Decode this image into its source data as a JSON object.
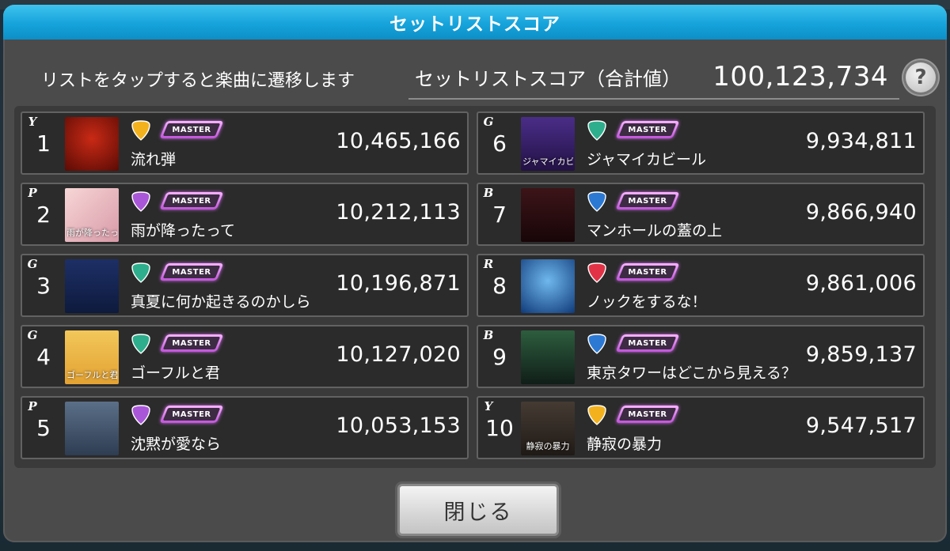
{
  "header": {
    "title": "セットリストスコア"
  },
  "hint": "リストをタップすると楽曲に遷移します",
  "total": {
    "label": "セットリストスコア（合計値）",
    "value": "100,123,734"
  },
  "help_label": "?",
  "close_label": "閉じる",
  "colors": {
    "Y": "#f3b21d",
    "P": "#a957d8",
    "G": "#2eae8c",
    "B": "#2c79d4",
    "R": "#e23346"
  },
  "rows": [
    {
      "rank": "1",
      "pick": "Y",
      "difficulty": "MASTER",
      "title": "流れ弾",
      "score": "10,465,166",
      "thumb_text": "",
      "thumb_bg": "radial-gradient(circle at 50% 40%, #c92a15, #5a0b05)"
    },
    {
      "rank": "2",
      "pick": "P",
      "difficulty": "MASTER",
      "title": "雨が降ったって",
      "score": "10,212,113",
      "thumb_text": "雨が降ったって",
      "thumb_bg": "linear-gradient(135deg,#f7d6d6,#d89aa8)"
    },
    {
      "rank": "3",
      "pick": "G",
      "difficulty": "MASTER",
      "title": "真夏に何か起きるのかしら",
      "score": "10,196,871",
      "thumb_text": "",
      "thumb_bg": "linear-gradient(180deg,#1d2f66,#0e1a3d)"
    },
    {
      "rank": "4",
      "pick": "G",
      "difficulty": "MASTER",
      "title": "ゴーフルと君",
      "score": "10,127,020",
      "thumb_text": "ゴーフルと君",
      "thumb_bg": "linear-gradient(180deg,#f2c75a,#e3a232)"
    },
    {
      "rank": "5",
      "pick": "P",
      "difficulty": "MASTER",
      "title": "沈黙が愛なら",
      "score": "10,053,153",
      "thumb_text": "",
      "thumb_bg": "linear-gradient(180deg,#5b6f88,#2e3d52)"
    },
    {
      "rank": "6",
      "pick": "G",
      "difficulty": "MASTER",
      "title": "ジャマイカビール",
      "score": "9,934,811",
      "thumb_text": "ジャマイカビール",
      "thumb_bg": "linear-gradient(180deg,#4a2d88,#231245)"
    },
    {
      "rank": "7",
      "pick": "B",
      "difficulty": "MASTER",
      "title": "マンホールの蓋の上",
      "score": "9,866,940",
      "thumb_text": "",
      "thumb_bg": "linear-gradient(180deg,#3c1418,#180608)"
    },
    {
      "rank": "8",
      "pick": "R",
      "difficulty": "MASTER",
      "title": "ノックをするな！",
      "score": "9,861,006",
      "thumb_text": "",
      "thumb_bg": "radial-gradient(circle at 50% 40%, #6fb8ee, #103a7a)"
    },
    {
      "rank": "9",
      "pick": "B",
      "difficulty": "MASTER",
      "title": "東京タワーはどこから見える？",
      "score": "9,859,137",
      "thumb_text": "",
      "thumb_bg": "linear-gradient(180deg,#2d5d3e,#101e18)"
    },
    {
      "rank": "10",
      "pick": "Y",
      "difficulty": "MASTER",
      "title": "静寂の暴力",
      "score": "9,547,517",
      "thumb_text": "静寂の暴力",
      "thumb_bg": "linear-gradient(180deg,#453b33,#201a16)"
    }
  ]
}
